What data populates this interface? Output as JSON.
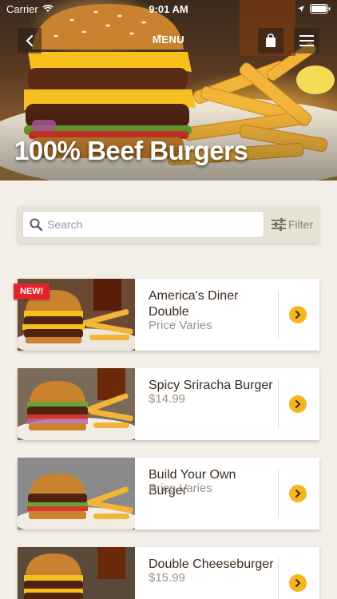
{
  "status_bar": {
    "carrier": "Carrier",
    "time": "9:01 AM"
  },
  "nav": {
    "title": "MENU"
  },
  "hero": {
    "title": "100% Beef Burgers"
  },
  "search": {
    "placeholder": "Search",
    "filter_label": "Filter"
  },
  "items": [
    {
      "name": "America's Diner Double",
      "price": "Price Varies",
      "badge": "NEW!"
    },
    {
      "name": "Spicy Sriracha Burger",
      "price": "$14.99"
    },
    {
      "name": "Build Your Own Burger",
      "price": "Price Varies"
    },
    {
      "name": "Double Cheeseburger",
      "price": "$15.99"
    }
  ],
  "colors": {
    "accent_yellow": "#f5b51f",
    "badge_red": "#e3232b",
    "brown_text": "#3b2a1e"
  },
  "icons": [
    "wifi-icon",
    "location-arrow-icon",
    "battery-icon",
    "back-chevron-icon",
    "shopping-bag-icon",
    "hamburger-menu-icon",
    "search-icon",
    "filter-icon",
    "chevron-right-icon"
  ]
}
